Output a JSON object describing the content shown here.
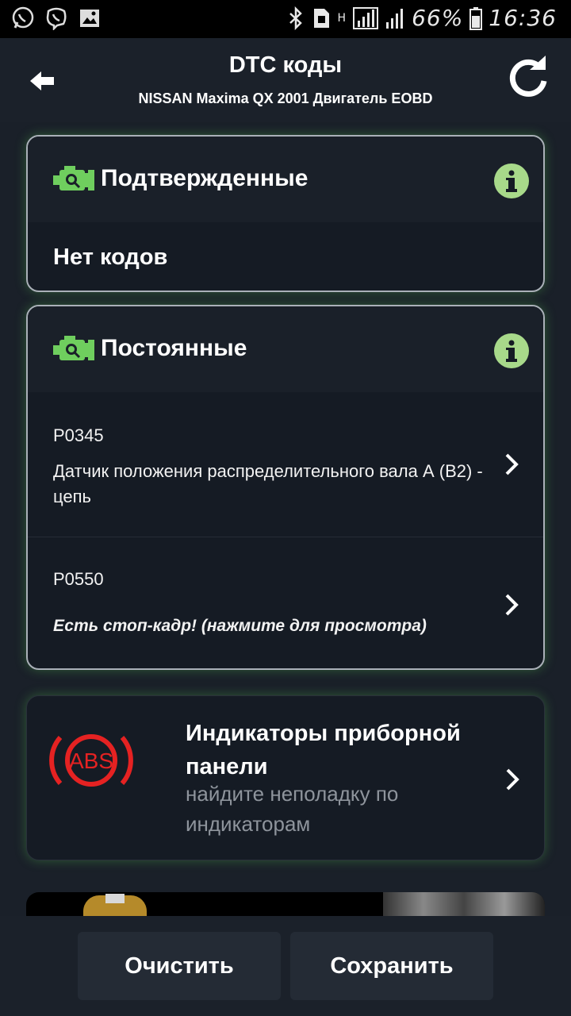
{
  "status_bar": {
    "battery_percent": "66%",
    "time": "16:36",
    "network_label": "H"
  },
  "header": {
    "title": "DTC коды",
    "subtitle": "NISSAN Maxima QX 2001 Двигатель EOBD"
  },
  "confirmed": {
    "title": "Подтвержденные",
    "empty_text": "Нет кодов"
  },
  "permanent": {
    "title": "Постоянные",
    "codes": [
      {
        "code": "P0345",
        "description": "Датчик положения распределительного вала А (B2) - цепь"
      },
      {
        "code": "P0550",
        "freeze_frame": "Есть стоп-кадр! (нажмите для просмотра)"
      }
    ]
  },
  "dashboard": {
    "title": "Индикаторы приборной панели",
    "subtitle": "найдите неполадку по индикаторам",
    "icon_text": "ABS"
  },
  "actions": {
    "clear_label": "Очистить",
    "save_label": "Сохранить"
  },
  "colors": {
    "accent_green": "#6fce5e",
    "info_green": "#a8d98a",
    "abs_red": "#e52222"
  }
}
